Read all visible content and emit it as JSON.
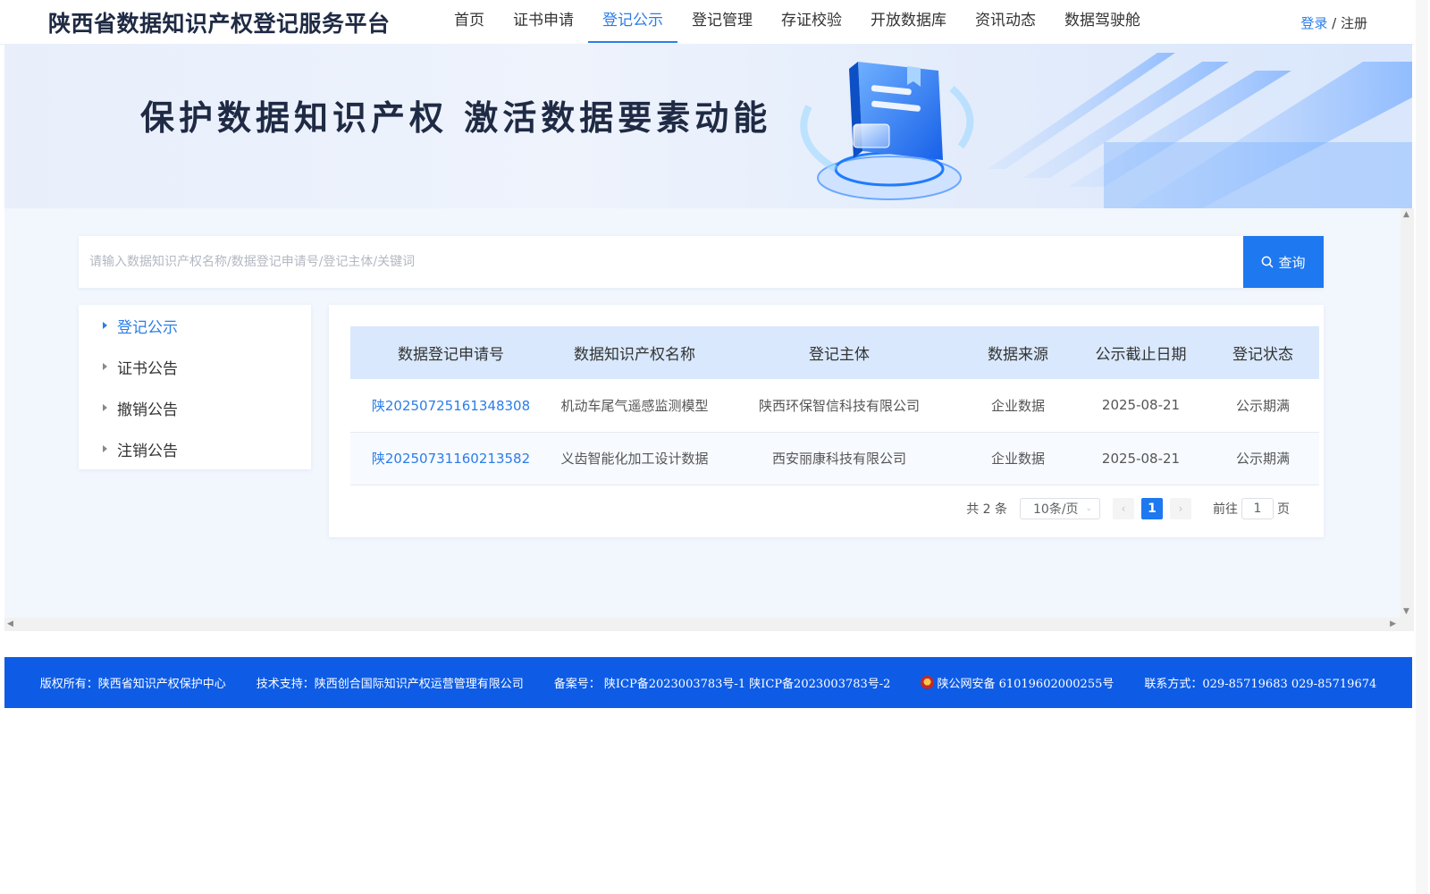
{
  "header": {
    "site_title": "陕西省数据知识产权登记服务平台",
    "nav": [
      "首页",
      "证书申请",
      "登记公示",
      "登记管理",
      "存证校验",
      "开放数据库",
      "资讯动态",
      "数据驾驶舱"
    ],
    "active_nav": "登记公示",
    "login": "登录",
    "separator": " / ",
    "register": "注册"
  },
  "banner": {
    "slogan": "保护数据知识产权 激活数据要素动能"
  },
  "search": {
    "placeholder": "请输入数据知识产权名称/数据登记申请号/登记主体/关键词",
    "button_label": "查询",
    "button_icon": "search-icon"
  },
  "sidebar": {
    "items": [
      "登记公示",
      "证书公告",
      "撤销公告",
      "注销公告"
    ],
    "active": "登记公示"
  },
  "table": {
    "columns": [
      "数据登记申请号",
      "数据知识产权名称",
      "登记主体",
      "数据来源",
      "公示截止日期",
      "登记状态"
    ],
    "rows": [
      [
        "陕20250725161348308",
        "机动车尾气遥感监测模型",
        "陕西环保智信科技有限公司",
        "企业数据",
        "2025-08-21",
        "公示期满"
      ],
      [
        "陕20250731160213582",
        "义齿智能化加工设计数据",
        "西安丽康科技有限公司",
        "企业数据",
        "2025-08-21",
        "公示期满"
      ]
    ]
  },
  "pagination": {
    "total": "共 2 条",
    "page_size": "10条/页",
    "current_page": "1",
    "goto_label": "前往",
    "goto_value": "1",
    "page_unit": "页"
  },
  "footer": {
    "copyright": "版权所有：陕西省知识产权保护中心",
    "tech_support": "技术支持：陕西创合国际知识产权运营管理有限公司",
    "icp": "备案号： 陕ICP备2023003783号-1 陕ICP备2023003783号-2",
    "police": "陕公网安备 61019602000255号",
    "contact": "联系方式：029-85719683 029-85719674"
  },
  "colors": {
    "primary": "#1e78ef",
    "active_text": "#2b7de9",
    "footer_bg": "#0e5ce6",
    "table_header_bg": "#d9e8fc"
  }
}
